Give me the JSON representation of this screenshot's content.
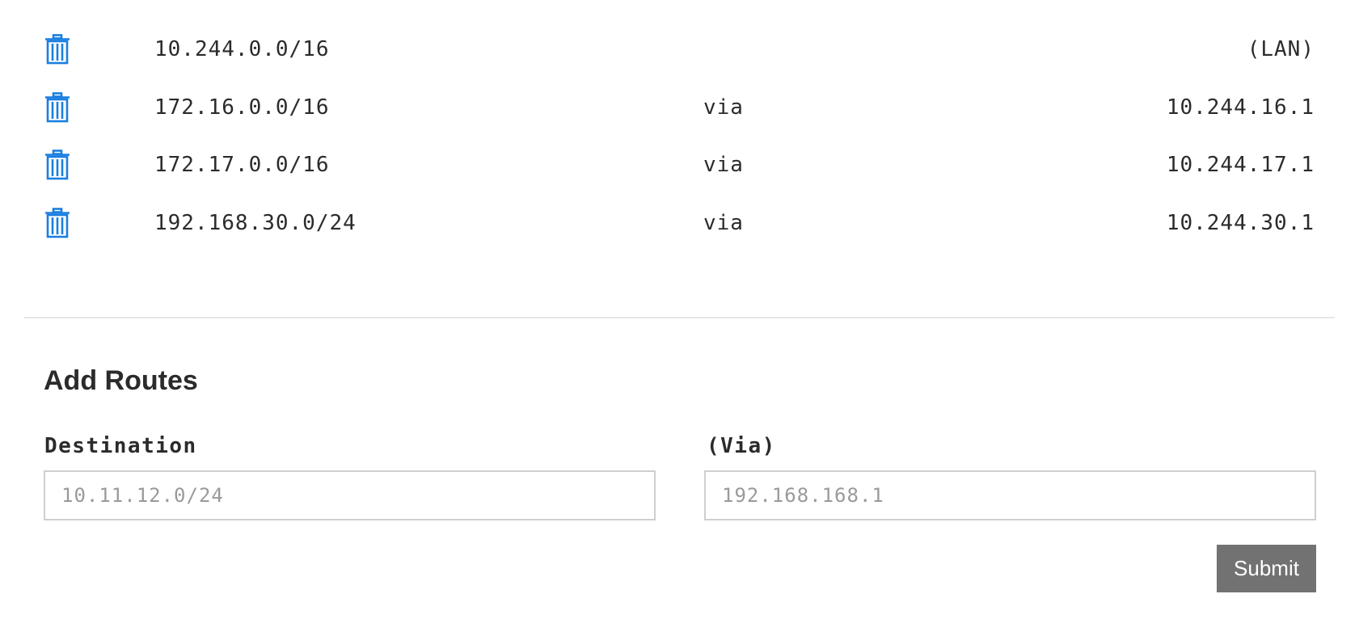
{
  "routes": [
    {
      "destination": "10.244.0.0/16",
      "via": "",
      "gateway": "(LAN)",
      "delete_icon": "trash-icon"
    },
    {
      "destination": "172.16.0.0/16",
      "via": "via",
      "gateway": "10.244.16.1",
      "delete_icon": "trash-icon"
    },
    {
      "destination": "172.17.0.0/16",
      "via": "via",
      "gateway": "10.244.17.1",
      "delete_icon": "trash-icon"
    },
    {
      "destination": "192.168.30.0/24",
      "via": "via",
      "gateway": "10.244.30.1",
      "delete_icon": "trash-icon"
    }
  ],
  "add_routes": {
    "title": "Add Routes",
    "destination_label": "Destination",
    "destination_placeholder": "10.11.12.0/24",
    "destination_value": "",
    "via_label": "(Via)",
    "via_placeholder": "192.168.168.1",
    "via_value": "",
    "submit_label": "Submit"
  },
  "colors": {
    "accent": "#1a7fe0",
    "text": "#2b2b2b",
    "submit_bg": "#727272",
    "divider": "#e6e6e6"
  }
}
